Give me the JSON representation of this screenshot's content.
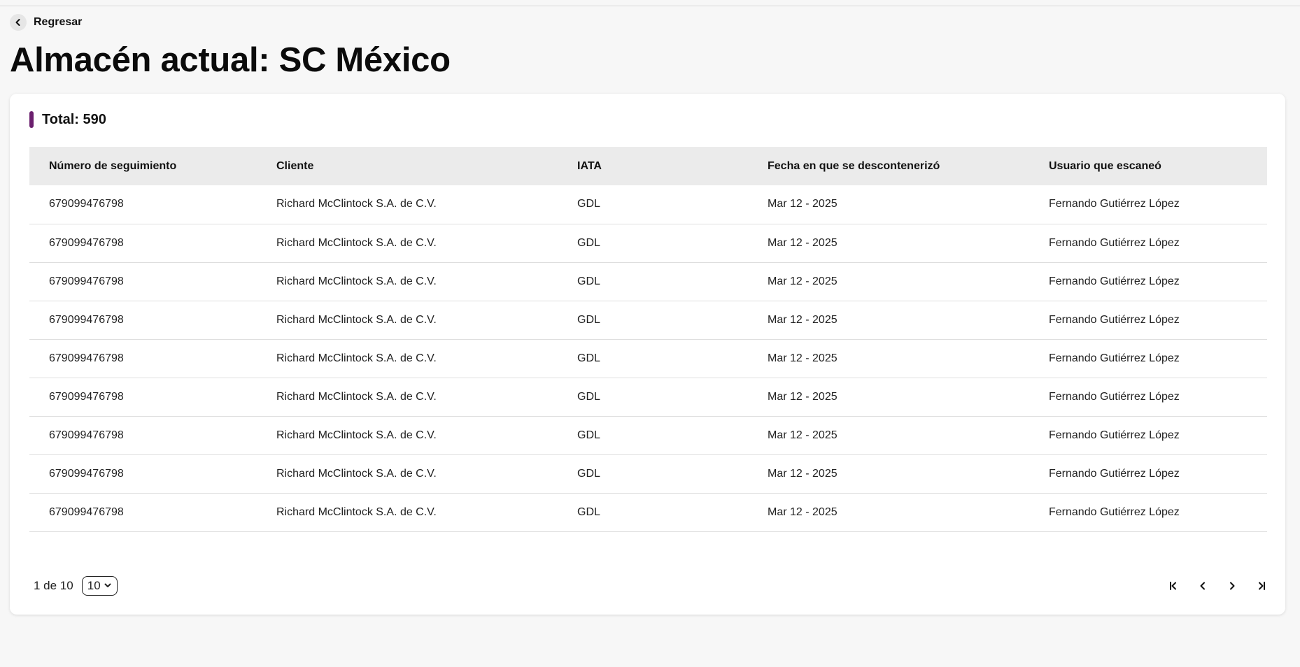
{
  "header": {
    "back_label": "Regresar",
    "title": "Almacén actual: SC México"
  },
  "card": {
    "total_label": "Total: 590",
    "accent_color": "#6b1f6e"
  },
  "table": {
    "columns": [
      "Número de seguimiento",
      "Cliente",
      "IATA",
      "Fecha en que se descontenerizó",
      "Usuario que escaneó"
    ],
    "rows": [
      [
        "679099476798",
        "Richard McClintock S.A. de C.V.",
        "GDL",
        "Mar 12 - 2025",
        "Fernando Gutiérrez López"
      ],
      [
        "679099476798",
        "Richard McClintock S.A. de C.V.",
        "GDL",
        "Mar 12 - 2025",
        "Fernando Gutiérrez López"
      ],
      [
        "679099476798",
        "Richard McClintock S.A. de C.V.",
        "GDL",
        "Mar 12 - 2025",
        "Fernando Gutiérrez López"
      ],
      [
        "679099476798",
        "Richard McClintock S.A. de C.V.",
        "GDL",
        "Mar 12 - 2025",
        "Fernando Gutiérrez López"
      ],
      [
        "679099476798",
        "Richard McClintock S.A. de C.V.",
        "GDL",
        "Mar 12 - 2025",
        "Fernando Gutiérrez López"
      ],
      [
        "679099476798",
        "Richard McClintock S.A. de C.V.",
        "GDL",
        "Mar 12 - 2025",
        "Fernando Gutiérrez López"
      ],
      [
        "679099476798",
        "Richard McClintock S.A. de C.V.",
        "GDL",
        "Mar 12 - 2025",
        "Fernando Gutiérrez López"
      ],
      [
        "679099476798",
        "Richard McClintock S.A. de C.V.",
        "GDL",
        "Mar 12 - 2025",
        "Fernando Gutiérrez López"
      ],
      [
        "679099476798",
        "Richard McClintock S.A. de C.V.",
        "GDL",
        "Mar 12 - 2025",
        "Fernando Gutiérrez López"
      ]
    ]
  },
  "pagination": {
    "page_text": "1 de 10",
    "page_size": "10",
    "icons": [
      "first-page-icon",
      "prev-page-icon",
      "next-page-icon",
      "last-page-icon"
    ]
  }
}
